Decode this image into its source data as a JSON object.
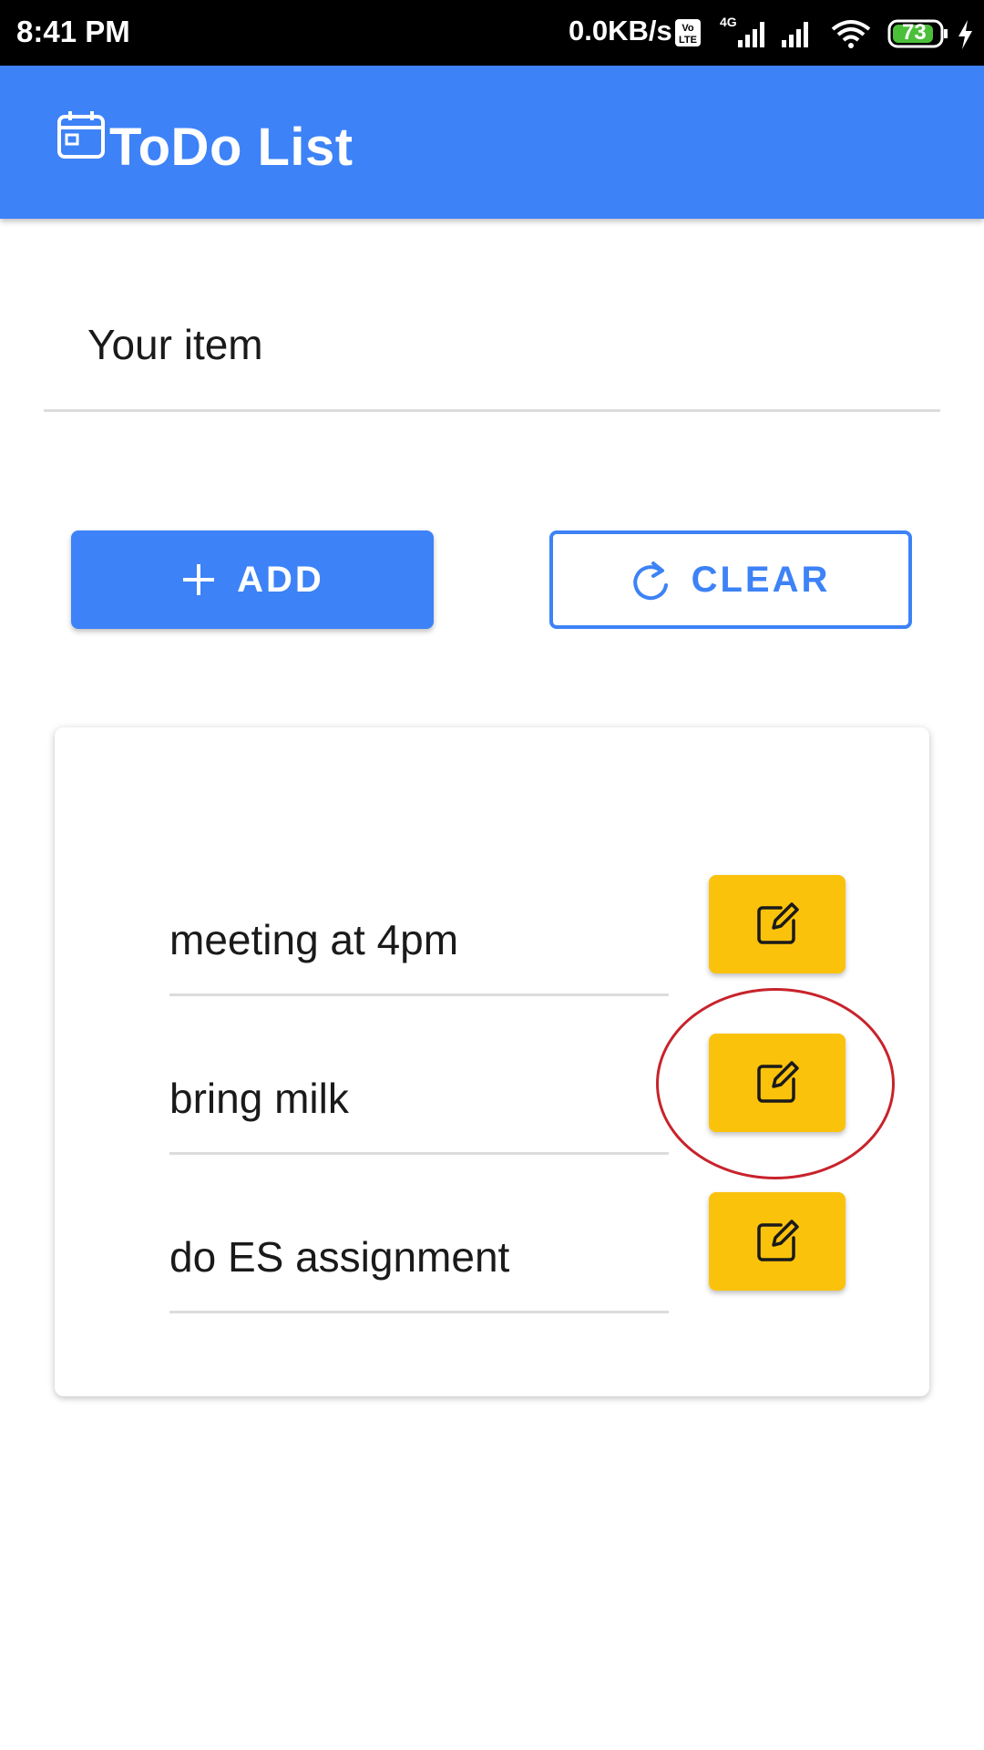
{
  "status_bar": {
    "time": "8:41 PM",
    "network_speed": "0.0KB/s",
    "volte_label": "Vo LTE",
    "network_type": "4G",
    "battery_level": "73",
    "icons": [
      "volte-icon",
      "cell-signal-icon",
      "cell-signal-icon",
      "wifi-icon",
      "battery-icon",
      "charging-icon"
    ]
  },
  "app_bar": {
    "title": "ToDo List",
    "icon": "calendar-icon",
    "color": "#3d82f7"
  },
  "input": {
    "placeholder": "Your item",
    "value": ""
  },
  "buttons": {
    "add_label": "ADD",
    "add_icon": "plus-icon",
    "clear_label": "CLEAR",
    "clear_icon": "refresh-icon"
  },
  "todos": [
    {
      "text": "meeting at 4pm",
      "action_icon": "edit-icon"
    },
    {
      "text": "bring milk",
      "action_icon": "edit-icon"
    },
    {
      "text": "do ES assignment",
      "action_icon": "edit-icon"
    }
  ],
  "colors": {
    "primary": "#3d82f7",
    "edit_button": "#fbc20c",
    "annotation": "#c8232c"
  }
}
